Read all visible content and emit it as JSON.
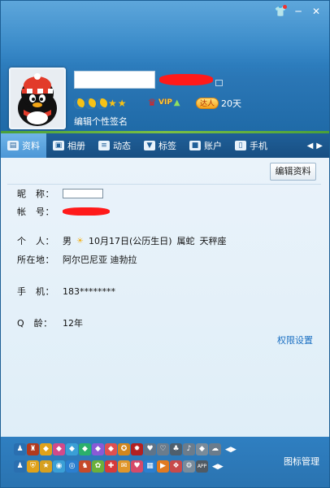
{
  "profile": {
    "signature": "编辑个性签名",
    "vip_label": "VIP",
    "daren_label": "达人",
    "days": "20天"
  },
  "tabs": [
    {
      "label": "资料",
      "icon": "profile-card-icon"
    },
    {
      "label": "相册",
      "icon": "photo-album-icon"
    },
    {
      "label": "动态",
      "icon": "feed-icon"
    },
    {
      "label": "标签",
      "icon": "bookmark-icon"
    },
    {
      "label": "账户",
      "icon": "briefcase-icon"
    },
    {
      "label": "手机",
      "icon": "phone-icon"
    }
  ],
  "content": {
    "edit_button": "编辑资料",
    "nickname_label": "昵　称：",
    "account_label": "帐　号：",
    "personal_label": "个　人：",
    "gender": "男",
    "birthday": "10月17日(公历生日)",
    "zodiac": "属蛇",
    "constellation": "天秤座",
    "location_label": "所在地：",
    "location": "阿尔巴尼亚 迪勃拉",
    "mobile_label": "手　机：",
    "mobile": "183********",
    "qage_label": "Q　龄：",
    "qage": "12年",
    "permission_link": "权限设置"
  },
  "footer": {
    "manage_label": "图标管理"
  },
  "colors": {
    "header": "#2f84c6",
    "tab_active": "#4c97d6",
    "link": "#1a6fc2",
    "redact": "#ff1a1a"
  }
}
